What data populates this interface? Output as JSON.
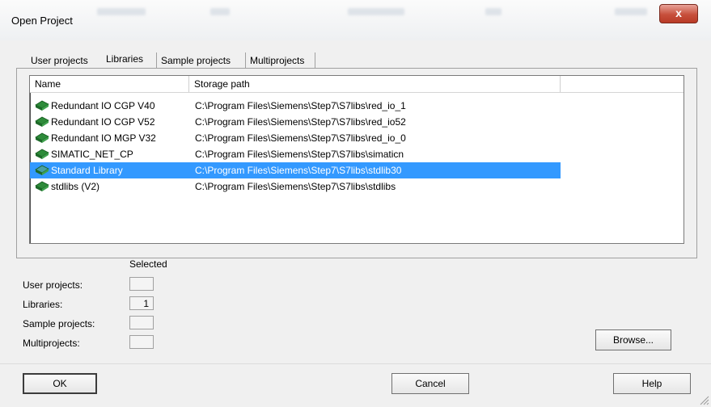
{
  "window": {
    "title": "Open Project",
    "close_label": "x"
  },
  "tabs": [
    {
      "label": "User projects",
      "active": false
    },
    {
      "label": "Libraries",
      "active": true
    },
    {
      "label": "Sample projects",
      "active": false
    },
    {
      "label": "Multiprojects",
      "active": false
    }
  ],
  "list": {
    "columns": [
      "Name",
      "Storage path"
    ],
    "rows": [
      {
        "name": "Redundant IO CGP V40",
        "path": "C:\\Program Files\\Siemens\\Step7\\S7libs\\red_io_1",
        "icon": "library-icon",
        "selected": false
      },
      {
        "name": "Redundant IO CGP V52",
        "path": "C:\\Program Files\\Siemens\\Step7\\S7libs\\red_io52",
        "icon": "library-icon",
        "selected": false
      },
      {
        "name": "Redundant IO MGP V32",
        "path": "C:\\Program Files\\Siemens\\Step7\\S7libs\\red_io_0",
        "icon": "library-icon",
        "selected": false
      },
      {
        "name": "SIMATIC_NET_CP",
        "path": "C:\\Program Files\\Siemens\\Step7\\S7libs\\simaticn",
        "icon": "library-icon",
        "selected": false
      },
      {
        "name": "Standard Library",
        "path": "C:\\Program Files\\Siemens\\Step7\\S7libs\\stdlib30",
        "icon": "library-icon",
        "selected": true
      },
      {
        "name": "stdlibs (V2)",
        "path": "C:\\Program Files\\Siemens\\Step7\\S7libs\\stdlibs",
        "icon": "library-icon",
        "selected": false
      }
    ]
  },
  "selected_panel": {
    "header": "Selected",
    "items": [
      {
        "label": "User projects:",
        "value": ""
      },
      {
        "label": "Libraries:",
        "value": "1"
      },
      {
        "label": "Sample projects:",
        "value": ""
      },
      {
        "label": "Multiprojects:",
        "value": ""
      }
    ]
  },
  "buttons": {
    "browse": "Browse...",
    "ok": "OK",
    "cancel": "Cancel",
    "help": "Help"
  },
  "colors": {
    "selection": "#3399ff",
    "close_button": "#c7503c",
    "library_icon": "#2e8b3a"
  }
}
